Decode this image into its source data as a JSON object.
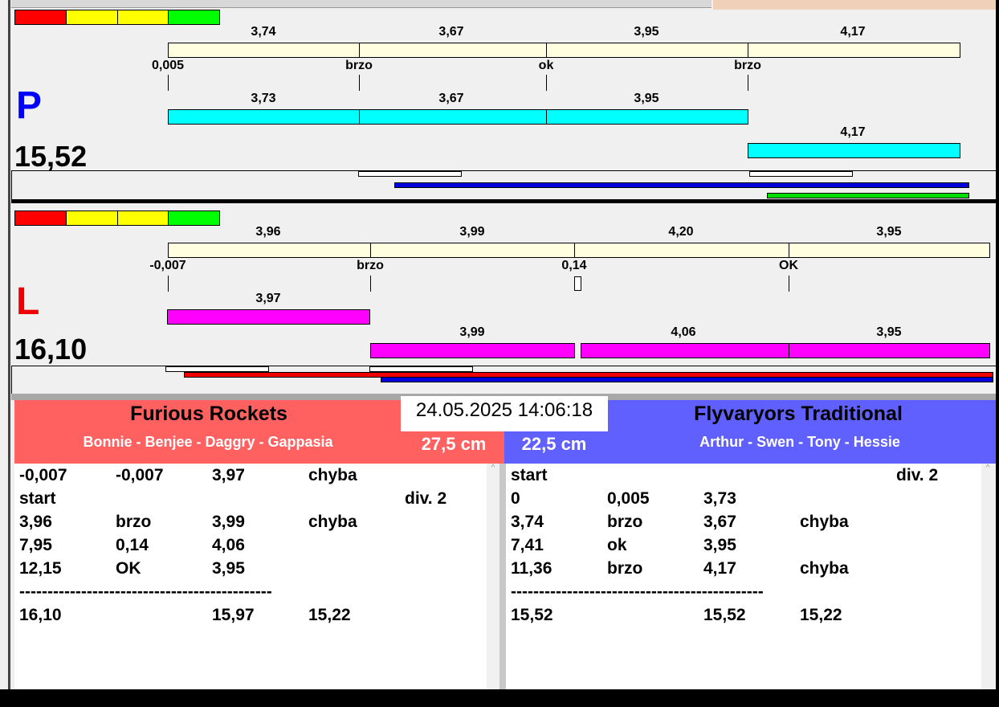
{
  "colors": {
    "red_team": "#ff6060",
    "blue_team": "#6060ff",
    "cream": "#ffffe0",
    "cyan": "#00ffff",
    "magenta": "#ff00ff"
  },
  "p_panel": {
    "letter": "P",
    "total": "15,52",
    "top_values": [
      "3,74",
      "3,67",
      "3,95",
      "4,17"
    ],
    "marks": [
      "0,005",
      "brzo",
      "ok",
      "brzo"
    ],
    "lane1_values": [
      "3,73",
      "3,67",
      "3,95"
    ],
    "lane2_values": [
      "4,17"
    ]
  },
  "l_panel": {
    "letter": "L",
    "total": "16,10",
    "top_values": [
      "3,96",
      "3,99",
      "4,20",
      "3,95"
    ],
    "marks": [
      "-0,007",
      "brzo",
      "0,14",
      "OK"
    ],
    "lane1_values": [
      "3,97"
    ],
    "lane2_values": [
      "3,99",
      "4,06",
      "3,95"
    ]
  },
  "datetime": "24.05.2025 14:06:18",
  "left_team": {
    "name": "Furious Rockets",
    "members": "Bonnie - Benjee - Daggry - Gappasia",
    "distance": "27,5 cm",
    "rows": [
      [
        "-0,007",
        "-0,007",
        "3,97",
        "chyba",
        ""
      ],
      [
        "start",
        "",
        "",
        "",
        "div.  2"
      ],
      [
        "3,96",
        "brzo",
        "3,99",
        "chyba",
        ""
      ],
      [
        "7,95",
        "0,14",
        "4,06",
        "",
        ""
      ],
      [
        "12,15",
        "OK",
        "3,95",
        "",
        ""
      ],
      [
        "---------------------------------------------",
        "",
        "",
        "",
        ""
      ],
      [
        "16,10",
        "",
        "15,97",
        "15,22",
        ""
      ]
    ]
  },
  "right_team": {
    "name": "Flyvaryors Traditional",
    "members": "Arthur - Swen - Tony - Hessie",
    "distance": "22,5 cm",
    "rows": [
      [
        "start",
        "",
        "",
        "",
        "div.  2"
      ],
      [
        "0",
        "0,005",
        "3,73",
        "",
        ""
      ],
      [
        "3,74",
        "brzo",
        "3,67",
        "chyba",
        ""
      ],
      [
        "7,41",
        "ok",
        "3,95",
        "",
        ""
      ],
      [
        "11,36",
        "brzo",
        "4,17",
        "chyba",
        ""
      ],
      [
        "---------------------------------------------",
        "",
        "",
        "",
        ""
      ],
      [
        "15,52",
        "",
        "15,52",
        "15,22",
        ""
      ]
    ]
  }
}
